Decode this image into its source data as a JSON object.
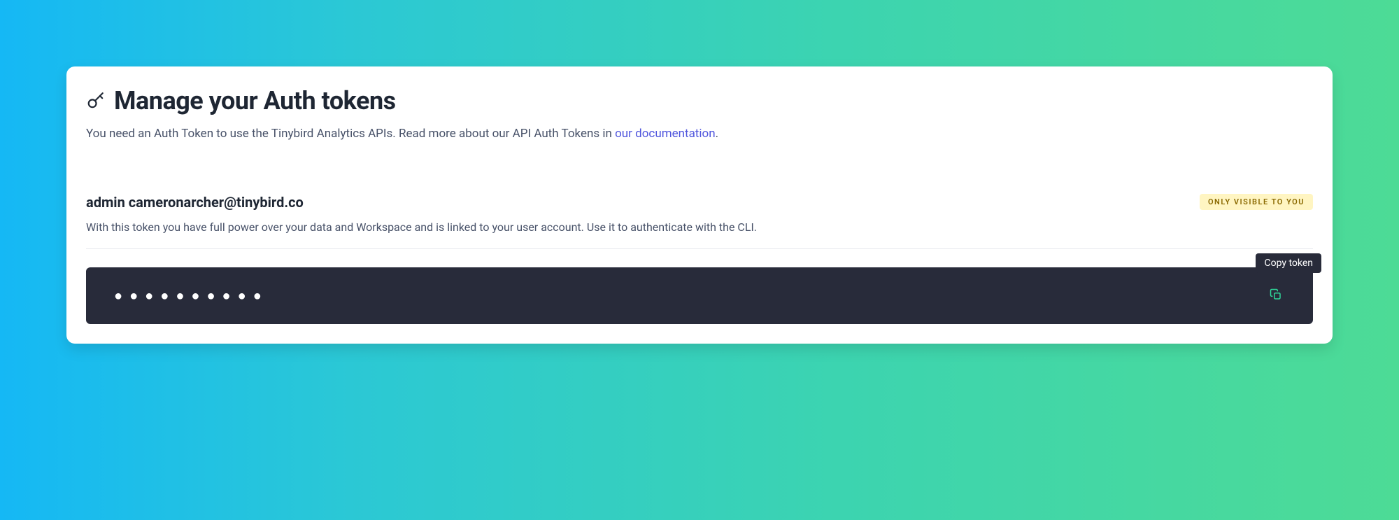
{
  "page": {
    "title": "Manage your Auth tokens",
    "description_prefix": "You need an Auth Token to use the Tinybird Analytics APIs. Read more about our API Auth Tokens in ",
    "description_link": "our documentation",
    "description_suffix": "."
  },
  "token": {
    "name": "admin cameronarcher@tinybird.co",
    "visibility_badge": "ONLY VISIBLE TO YOU",
    "description": "With this token you have full power over your data and Workspace and is linked to your user account. Use it to authenticate with the CLI.",
    "masked_value": "●●●●●●●●●●",
    "copy_tooltip": "Copy token"
  }
}
